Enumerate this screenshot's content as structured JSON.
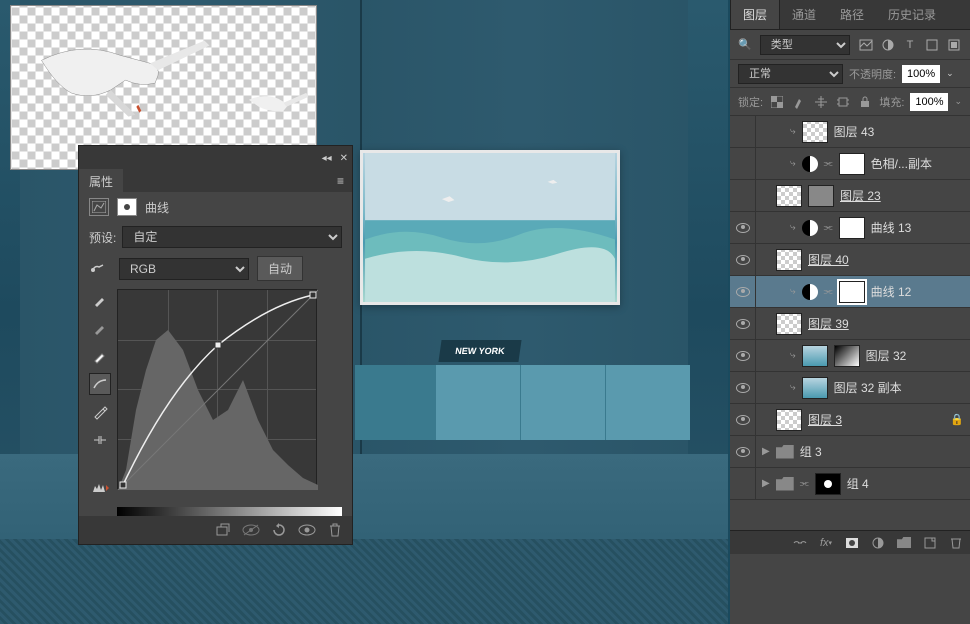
{
  "canvas": {
    "newyork_sign": "NEW YORK"
  },
  "properties": {
    "title": "属性",
    "adjustment_label": "曲线",
    "preset_label": "预设:",
    "preset_value": "自定",
    "channel_value": "RGB",
    "auto_label": "自动"
  },
  "layers_panel": {
    "tabs": [
      "图层",
      "通道",
      "路径",
      "历史记录"
    ],
    "type_label": "类型",
    "blend_mode": "正常",
    "opacity_label": "不透明度:",
    "opacity_value": "100%",
    "lock_label": "锁定:",
    "fill_label": "填充:",
    "fill_value": "100%",
    "layers": [
      {
        "name": "图层 43",
        "visible": false,
        "indent": 2,
        "clip": true,
        "thumb": "checker"
      },
      {
        "name": "色相/...副本",
        "visible": false,
        "indent": 2,
        "clip": true,
        "adj": true,
        "linked": true,
        "thumb": "white"
      },
      {
        "name": "图层 23",
        "visible": false,
        "indent": 1,
        "thumb": "checker",
        "mask": "line",
        "underline": true
      },
      {
        "name": "曲线 13",
        "visible": true,
        "indent": 2,
        "clip": true,
        "adj": true,
        "linked": true,
        "thumb": "white"
      },
      {
        "name": "图层 40",
        "visible": true,
        "indent": 1,
        "thumb": "checker",
        "underline": true
      },
      {
        "name": "曲线 12",
        "visible": true,
        "indent": 2,
        "clip": true,
        "adj": true,
        "linked": true,
        "thumb": "white",
        "selected": true
      },
      {
        "name": "图层 39",
        "visible": true,
        "indent": 1,
        "thumb": "checker",
        "underline": true
      },
      {
        "name": "图层 32",
        "visible": true,
        "indent": 2,
        "clip": true,
        "thumb": "ocean",
        "mask": "dark-grad"
      },
      {
        "name": "图层 32 副本",
        "visible": true,
        "indent": 2,
        "clip": true,
        "thumb": "ocean"
      },
      {
        "name": "图层 3",
        "visible": true,
        "indent": 1,
        "thumb": "checker",
        "underline": true,
        "locked": true
      },
      {
        "name": "组 3",
        "visible": true,
        "indent": 0,
        "folder": true
      },
      {
        "name": "组 4",
        "visible": false,
        "indent": 0,
        "folder": true,
        "linked": true,
        "mask": "black-dot"
      }
    ]
  }
}
